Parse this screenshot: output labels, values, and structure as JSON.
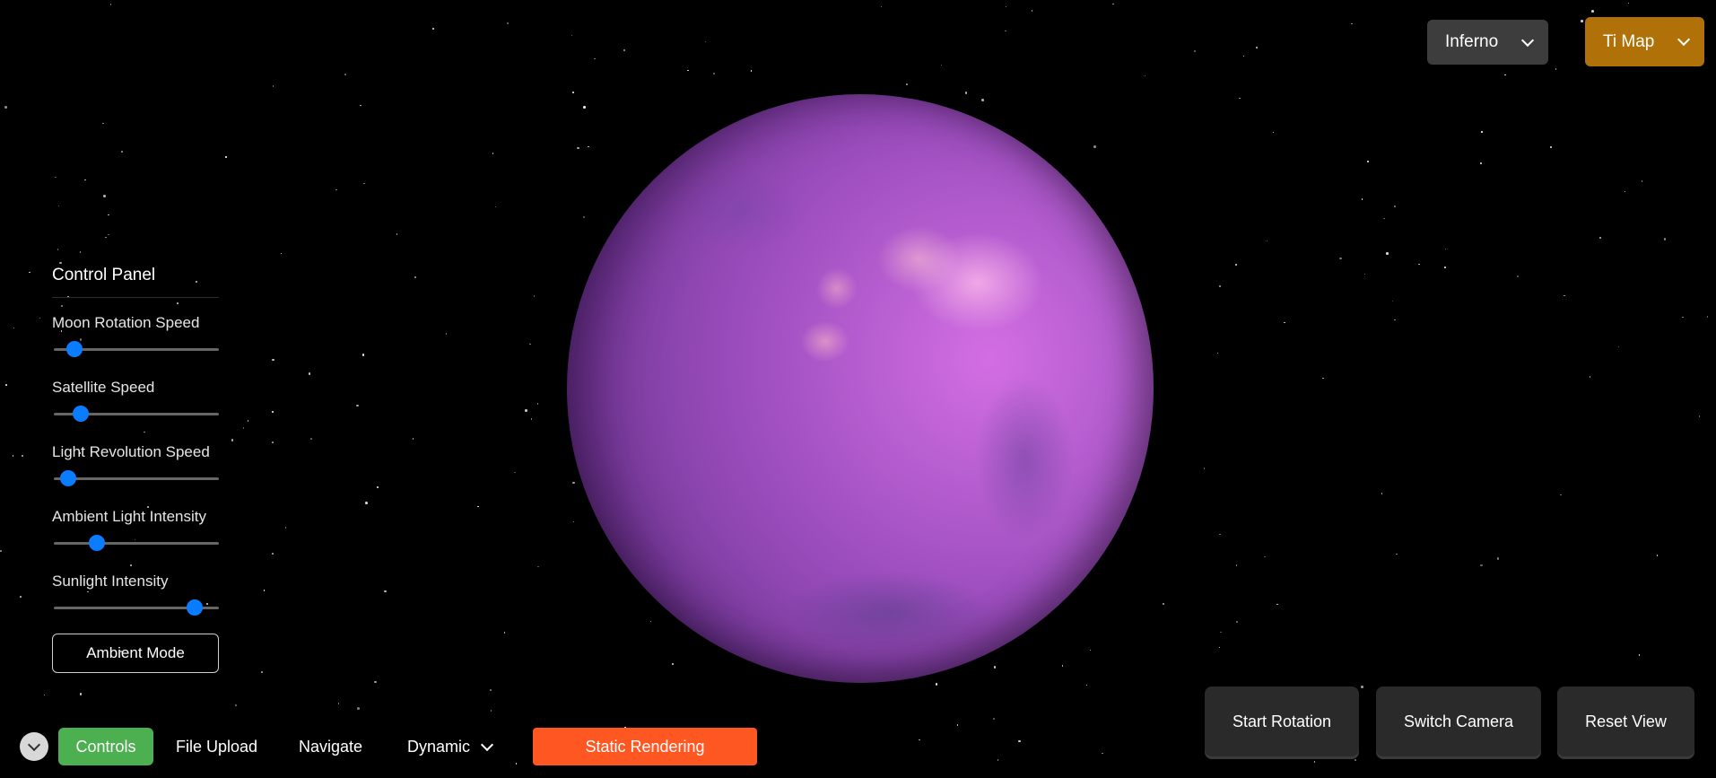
{
  "top_controls": {
    "colormap_dropdown": {
      "selected": "Inferno"
    },
    "map_dropdown": {
      "selected": "Ti Map"
    }
  },
  "control_panel": {
    "title": "Control Panel",
    "sliders": [
      {
        "label": "Moon Rotation Speed",
        "value_fraction": 0.09
      },
      {
        "label": "Satellite Speed",
        "value_fraction": 0.13
      },
      {
        "label": "Light Revolution Speed",
        "value_fraction": 0.05
      },
      {
        "label": "Ambient Light Intensity",
        "value_fraction": 0.24
      },
      {
        "label": "Sunlight Intensity",
        "value_fraction": 0.9
      }
    ],
    "ambient_button": "Ambient Mode"
  },
  "toolbar": {
    "controls": "Controls",
    "file_upload": "File Upload",
    "navigate": "Navigate",
    "dynamic": "Dynamic",
    "static_rendering": "Static Rendering"
  },
  "actions": {
    "start_rotation": "Start Rotation",
    "switch_camera": "Switch Camera",
    "reset_view": "Reset View"
  },
  "colors": {
    "background": "#000000",
    "moon_base": "#a04fc4",
    "slider_accent": "#0a7cff",
    "controls_active": "#4caf50",
    "static_rendering": "#ff5722",
    "ti_map": "#b07208"
  },
  "icons": {
    "dropdown": "chevron-down-icon",
    "collapse": "chevron-down-circle-icon"
  }
}
